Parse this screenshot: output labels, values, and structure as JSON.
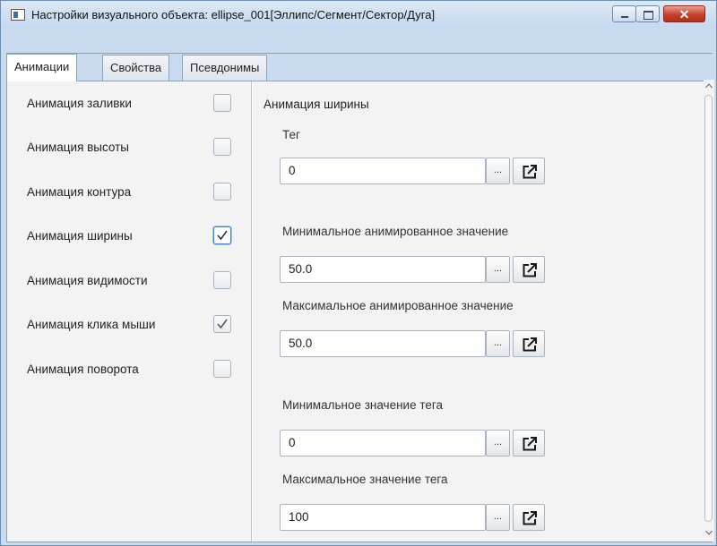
{
  "window": {
    "title": "Настройки визуального объекта: ellipse_001[Эллипс/Сегмент/Сектор/Дуга]",
    "close_symbol": "✕"
  },
  "tabs": [
    {
      "label": "Анимации",
      "active": true
    },
    {
      "label": "Свойства",
      "active": false
    },
    {
      "label": "Псевдонимы",
      "active": false
    }
  ],
  "animations": [
    {
      "label": "Анимация заливки",
      "checked": false
    },
    {
      "label": "Анимация высоты",
      "checked": false
    },
    {
      "label": "Анимация контура",
      "checked": false
    },
    {
      "label": "Анимация ширины",
      "checked": true,
      "focused": true
    },
    {
      "label": "Анимация видимости",
      "checked": false
    },
    {
      "label": "Анимация клика мыши",
      "checked": true
    },
    {
      "label": "Анимация поворота",
      "checked": false
    }
  ],
  "details": {
    "section_title": "Анимация ширины",
    "dots_label": "...",
    "fields": [
      {
        "label": "Тег",
        "value": "0"
      },
      {
        "label": "Минимальное анимированное значение",
        "value": "50.0"
      },
      {
        "label": "Максимальное анимированное значение",
        "value": "50.0"
      },
      {
        "label": "Минимальное значение тега",
        "value": "0"
      },
      {
        "label": "Максимальное значение тега",
        "value": "100"
      }
    ]
  },
  "icons": {
    "app": "window-app-icon",
    "minimize": "minimize-icon",
    "maximize": "maximize-icon",
    "close": "close-icon",
    "open": "open-external-icon",
    "check": "checkmark-icon"
  }
}
